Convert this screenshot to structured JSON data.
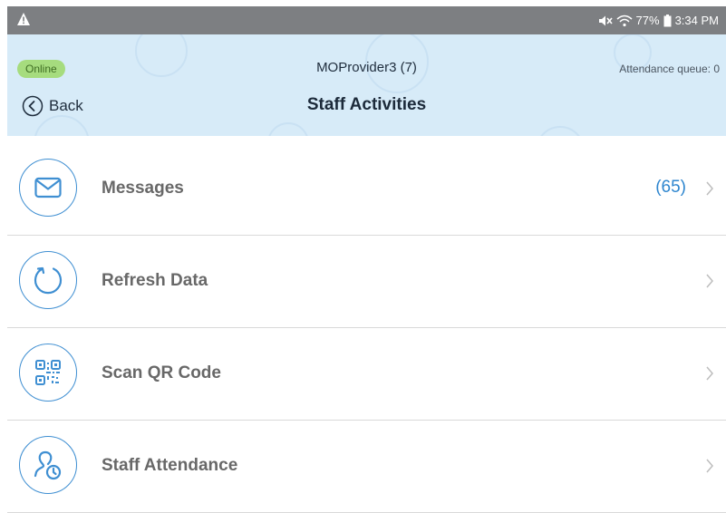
{
  "status_bar": {
    "battery": "77%",
    "time": "3:34 PM",
    "warning_icon": "warning-triangle-icon",
    "mute_icon": "mute-icon",
    "wifi_icon": "wifi-icon",
    "battery_icon": "battery-icon"
  },
  "header": {
    "online_label": "Online",
    "provider_title": "MOProvider3 (7)",
    "queue_text": "Attendance queue: 0",
    "back_label": "Back",
    "page_title": "Staff Activities"
  },
  "menu": {
    "items": [
      {
        "label": "Messages",
        "count": "(65)",
        "icon": "envelope-icon"
      },
      {
        "label": "Refresh Data",
        "count": "",
        "icon": "refresh-icon"
      },
      {
        "label": "Scan QR Code",
        "count": "",
        "icon": "qr-code-icon"
      },
      {
        "label": "Staff Attendance",
        "count": "",
        "icon": "staff-attendance-icon"
      }
    ]
  },
  "colors": {
    "status_bar_bg": "#7d7f82",
    "header_bg": "#d7ebf8",
    "accent_blue": "#3f8fd2",
    "online_badge_bg": "#a6dc7e",
    "label_gray": "#686868"
  }
}
